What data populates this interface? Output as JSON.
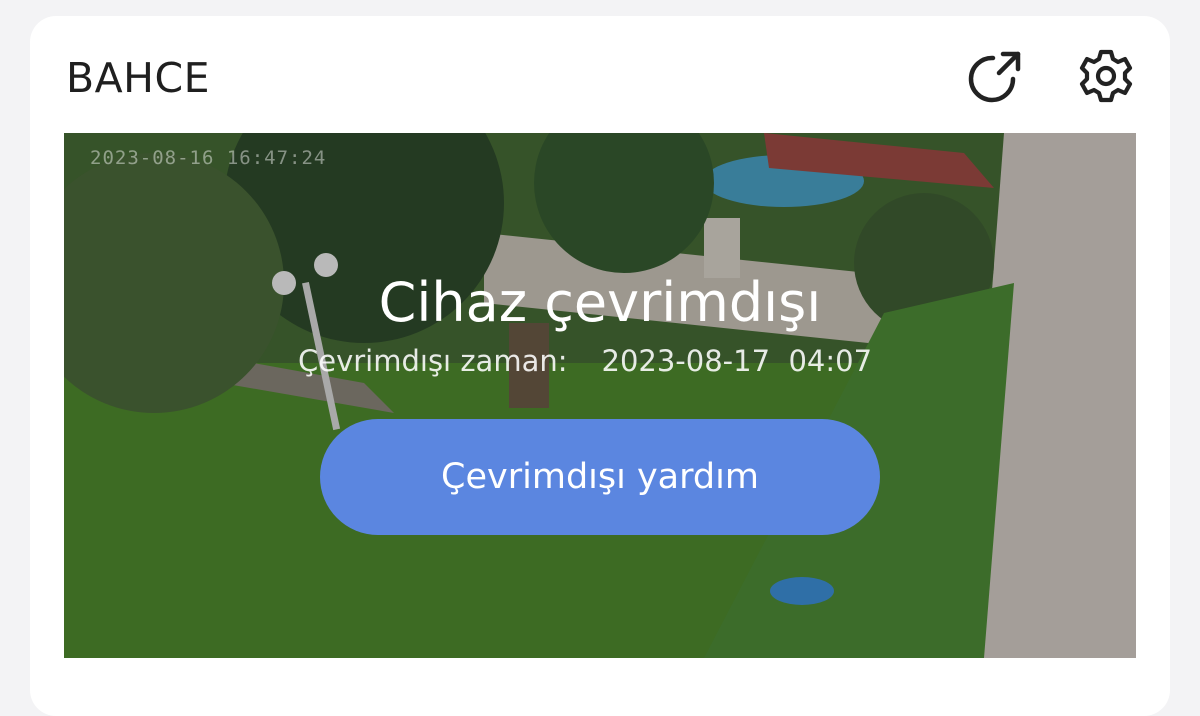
{
  "header": {
    "title": "BAHCE",
    "share_icon": "share-external-icon",
    "settings_icon": "gear-icon"
  },
  "preview": {
    "camera_timestamp": "2023-08-16 16:47:24",
    "status_title": "Cihaz çevrimdışı",
    "offline_time_label": "Çevrimdışı zaman:",
    "offline_time_value": "2023-08-17  04:07",
    "help_button_label": "Çevrimdışı yardım",
    "accent_color": "#5b86e0"
  }
}
